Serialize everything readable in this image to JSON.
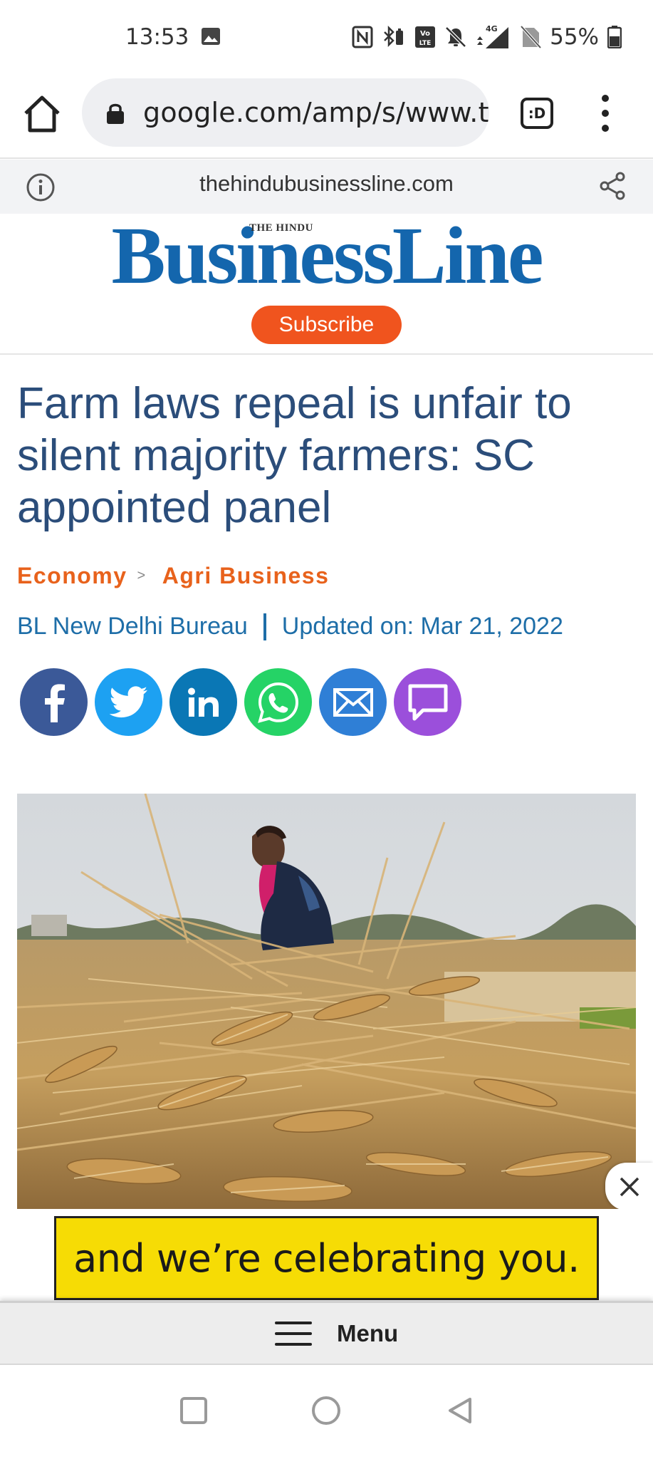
{
  "status_bar": {
    "time": "13:53",
    "battery": "55%",
    "network": "4G",
    "icons": [
      "image-icon",
      "nfc-icon",
      "bluetooth-battery-icon",
      "volte-icon",
      "mute-icon",
      "signal-4g-icon",
      "no-sim-icon",
      "battery-icon"
    ]
  },
  "browser": {
    "url": "google.com/amp/s/www.thehindubusinessline.com",
    "tab_count": ":D"
  },
  "amp_header": {
    "domain": "thehindubusinessline.com"
  },
  "site": {
    "logo": "BusinessLine",
    "logo_super": "THE HINDU",
    "subscribe_label": "Subscribe",
    "brand_color": "#1466ad",
    "accent_color": "#f0541e"
  },
  "article": {
    "headline": "Farm laws repeal is unfair to silent majority farmers: SC appointed panel",
    "breadcrumb": [
      "Economy",
      "Agri Business"
    ],
    "breadcrumb_separator": ">",
    "author": "BL New Delhi Bureau",
    "updated": "Updated on: Mar 21, 2022"
  },
  "share_buttons": [
    {
      "network": "facebook",
      "color": "#3b5998"
    },
    {
      "network": "twitter",
      "color": "#1da1f2"
    },
    {
      "network": "linkedin",
      "color": "#0a77b5"
    },
    {
      "network": "whatsapp",
      "color": "#25d366"
    },
    {
      "network": "email",
      "color": "#2f7fd6"
    },
    {
      "network": "comments",
      "color": "#9b4fdb"
    }
  ],
  "ad": {
    "text": "and we’re celebrating you."
  },
  "menu": {
    "label": "Menu"
  }
}
